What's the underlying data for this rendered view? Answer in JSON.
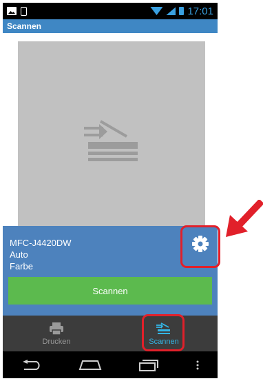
{
  "status_bar": {
    "time": "17:01"
  },
  "action_bar": {
    "title": "Scannen"
  },
  "panel": {
    "device": "MFC-J4420DW",
    "mode": "Auto",
    "color": "Farbe",
    "scan_button_label": "Scannen"
  },
  "tabs": [
    {
      "label": "Drucken",
      "icon": "printer-icon",
      "active": false
    },
    {
      "label": "Scannen",
      "icon": "scanner-icon",
      "active": true
    }
  ],
  "nav_icons": [
    "back-icon",
    "home-icon",
    "recent-apps-icon",
    "overflow-menu-icon"
  ],
  "colors": {
    "action_bar": "#3f87c4",
    "panel": "#4d82bd",
    "scan_button": "#5cba4e",
    "active_tab": "#33b5e5",
    "highlight": "#e1202a"
  }
}
